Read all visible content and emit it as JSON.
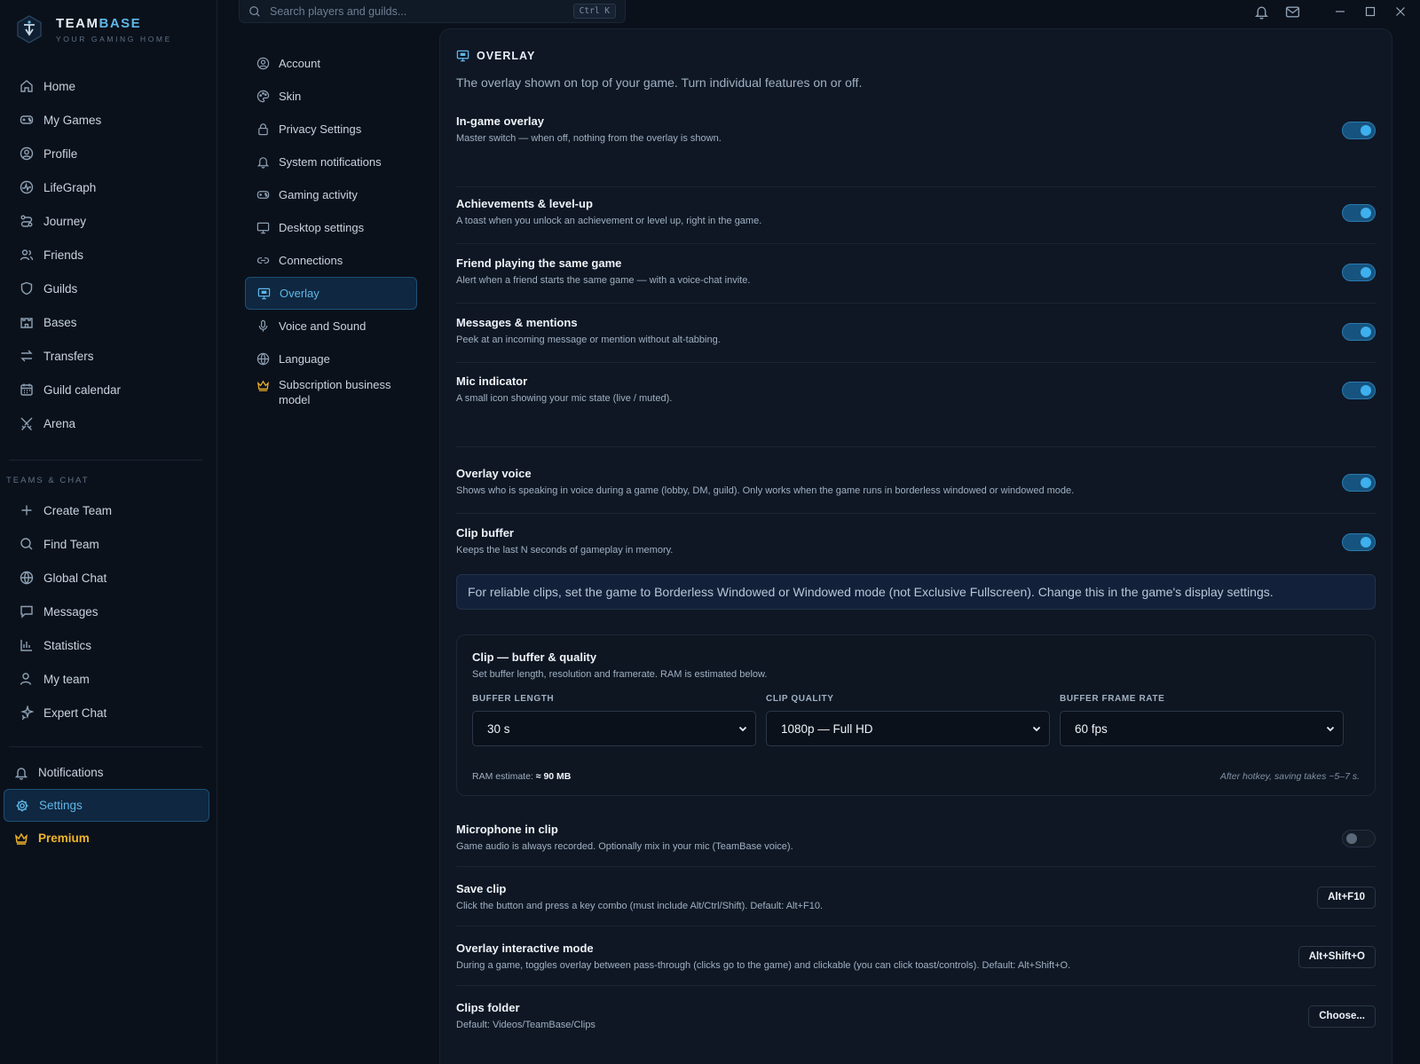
{
  "brand": {
    "name_part1": "TEAM",
    "name_part2": "BASE",
    "tagline": "YOUR GAMING HOME"
  },
  "search": {
    "placeholder": "Search players and guilds...",
    "shortcut": "Ctrl K"
  },
  "nav": {
    "main": [
      {
        "label": "Home",
        "icon": "home-icon"
      },
      {
        "label": "My Games",
        "icon": "gamepad-icon"
      },
      {
        "label": "Profile",
        "icon": "user-circle-icon"
      },
      {
        "label": "LifeGraph",
        "icon": "lifegraph-icon"
      },
      {
        "label": "Journey",
        "icon": "route-icon"
      },
      {
        "label": "Friends",
        "icon": "users-icon"
      },
      {
        "label": "Guilds",
        "icon": "shield-icon"
      },
      {
        "label": "Bases",
        "icon": "castle-icon"
      },
      {
        "label": "Transfers",
        "icon": "transfer-icon"
      },
      {
        "label": "Guild calendar",
        "icon": "calendar-icon"
      },
      {
        "label": "Arena",
        "icon": "swords-icon"
      }
    ],
    "section_label": "TEAMS & CHAT",
    "teams": [
      {
        "label": "Create Team",
        "icon": "plus-icon"
      },
      {
        "label": "Find Team",
        "icon": "search-icon"
      },
      {
        "label": "Global Chat",
        "icon": "globe-icon"
      },
      {
        "label": "Messages",
        "icon": "message-icon"
      },
      {
        "label": "Statistics",
        "icon": "bar-chart-icon"
      },
      {
        "label": "My team",
        "icon": "user-icon"
      },
      {
        "label": "Expert Chat",
        "icon": "sparkle-icon"
      }
    ],
    "bottom": [
      {
        "label": "Notifications",
        "icon": "bell-icon"
      },
      {
        "label": "Settings",
        "icon": "gear-icon"
      },
      {
        "label": "Premium",
        "icon": "crown-icon"
      }
    ]
  },
  "settings_nav": [
    {
      "label": "Account",
      "icon": "user-circle-icon"
    },
    {
      "label": "Skin",
      "icon": "palette-icon"
    },
    {
      "label": "Privacy Settings",
      "icon": "lock-icon"
    },
    {
      "label": "System notifications",
      "icon": "bell-icon"
    },
    {
      "label": "Gaming activity",
      "icon": "gamepad-icon"
    },
    {
      "label": "Desktop settings",
      "icon": "monitor-icon"
    },
    {
      "label": "Connections",
      "icon": "link-icon"
    },
    {
      "label": "Overlay",
      "icon": "overlay-icon"
    },
    {
      "label": "Voice and Sound",
      "icon": "mic-icon"
    },
    {
      "label": "Language",
      "icon": "globe-icon"
    },
    {
      "label": "Subscription business model",
      "icon": "crown-icon"
    }
  ],
  "overlay": {
    "title": "OVERLAY",
    "description": "The overlay shown on top of your game. Turn individual features on or off.",
    "settings": [
      {
        "title": "In-game overlay",
        "desc": "Master switch — when off, nothing from the overlay is shown.",
        "enabled": true
      },
      {
        "title": "Achievements & level-up",
        "desc": "A toast when you unlock an achievement or level up, right in the game.",
        "enabled": true
      },
      {
        "title": "Friend playing the same game",
        "desc": "Alert when a friend starts the same game — with a voice-chat invite.",
        "enabled": true
      },
      {
        "title": "Messages & mentions",
        "desc": "Peek at an incoming message or mention without alt-tabbing.",
        "enabled": true
      },
      {
        "title": "Mic indicator",
        "desc": "A small icon showing your mic state (live / muted).",
        "enabled": true
      },
      {
        "title": "Overlay voice",
        "desc": "Shows who is speaking in voice during a game (lobby, DM, guild). Only works when the game runs in borderless windowed or windowed mode.",
        "enabled": true
      },
      {
        "title": "Clip buffer",
        "desc": "Keeps the last N seconds of gameplay in memory.",
        "enabled": true
      }
    ],
    "clip_notice": "For reliable clips, set the game to Borderless Windowed or Windowed mode (not Exclusive Fullscreen). Change this in the game's display settings.",
    "clip_quality": {
      "title": "Clip — buffer & quality",
      "desc": "Set buffer length, resolution and framerate. RAM is estimated below.",
      "buffer_length_label": "BUFFER LENGTH",
      "buffer_length_value": "30 s",
      "clip_quality_label": "CLIP QUALITY",
      "clip_quality_value": "1080p — Full HD",
      "frame_rate_label": "BUFFER FRAME RATE",
      "frame_rate_value": "60 fps",
      "ram_label": "RAM estimate:",
      "ram_value": "≈ 90 MB",
      "hotkey_note": "After hotkey, saving takes ~5–7 s."
    },
    "microphone": {
      "title": "Microphone in clip",
      "desc": "Game audio is always recorded. Optionally mix in your mic (TeamBase voice).",
      "enabled": false
    },
    "save_clip": {
      "title": "Save clip",
      "desc": "Click the button and press a key combo (must include Alt/Ctrl/Shift). Default: Alt+F10.",
      "key": "Alt+F10"
    },
    "interactive_mode": {
      "title": "Overlay interactive mode",
      "desc": "During a game, toggles overlay between pass-through (clicks go to the game) and clickable (you can click toast/controls). Default: Alt+Shift+O.",
      "key": "Alt+Shift+O"
    },
    "clips_folder": {
      "title": "Clips folder",
      "desc": "Default: Videos/TeamBase/Clips",
      "button": "Choose..."
    }
  }
}
